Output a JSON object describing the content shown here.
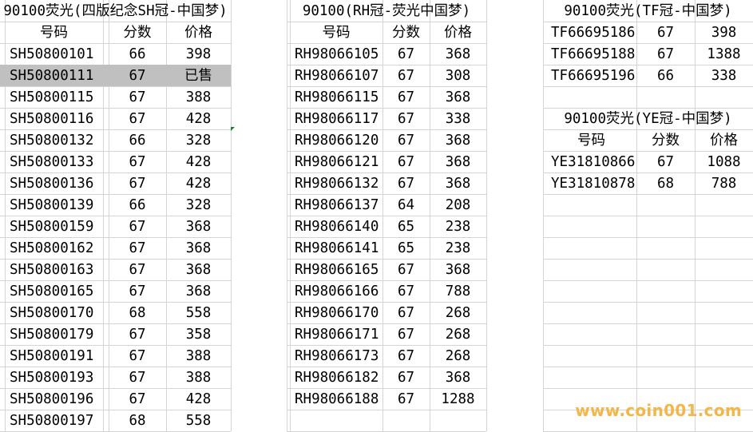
{
  "sections": [
    {
      "title": "90100荧光(四版纪念SH冠-中国梦)",
      "headers": [
        "号码",
        "分数",
        "价格"
      ],
      "rows": [
        [
          "SH50800101",
          "66",
          "398"
        ],
        [
          "SH50800111",
          "67",
          "已售"
        ],
        [
          "SH50800115",
          "67",
          "388"
        ],
        [
          "SH50800116",
          "67",
          "428"
        ],
        [
          "SH50800132",
          "66",
          "328"
        ],
        [
          "SH50800133",
          "67",
          "428"
        ],
        [
          "SH50800136",
          "67",
          "428"
        ],
        [
          "SH50800139",
          "66",
          "328"
        ],
        [
          "SH50800159",
          "67",
          "368"
        ],
        [
          "SH50800162",
          "67",
          "368"
        ],
        [
          "SH50800163",
          "67",
          "368"
        ],
        [
          "SH50800165",
          "67",
          "368"
        ],
        [
          "SH50800170",
          "68",
          "558"
        ],
        [
          "SH50800179",
          "67",
          "358"
        ],
        [
          "SH50800191",
          "67",
          "388"
        ],
        [
          "SH50800193",
          "67",
          "388"
        ],
        [
          "SH50800196",
          "67",
          "428"
        ],
        [
          "SH50800197",
          "68",
          "558"
        ]
      ]
    },
    {
      "title": "90100(RH冠-荧光中国梦)",
      "headers": [
        "号码",
        "分数",
        "价格"
      ],
      "rows": [
        [
          "RH98066105",
          "67",
          "368"
        ],
        [
          "RH98066107",
          "67",
          "308"
        ],
        [
          "RH98066115",
          "67",
          "368"
        ],
        [
          "RH98066117",
          "67",
          "338"
        ],
        [
          "RH98066120",
          "67",
          "368"
        ],
        [
          "RH98066121",
          "67",
          "368"
        ],
        [
          "RH98066132",
          "67",
          "368"
        ],
        [
          "RH98066137",
          "64",
          "208"
        ],
        [
          "RH98066140",
          "65",
          "238"
        ],
        [
          "RH98066141",
          "65",
          "238"
        ],
        [
          "RH98066165",
          "67",
          "368"
        ],
        [
          "RH98066166",
          "67",
          "788"
        ],
        [
          "RH98066170",
          "67",
          "268"
        ],
        [
          "RH98066171",
          "67",
          "268"
        ],
        [
          "RH98066173",
          "67",
          "268"
        ],
        [
          "RH98066182",
          "67",
          "368"
        ],
        [
          "RH98066188",
          "67",
          "1288"
        ]
      ]
    },
    {
      "title": "90100荧光(TF冠-中国梦)",
      "rows": [
        [
          "TF66695186",
          "67",
          "398"
        ],
        [
          "TF66695188",
          "67",
          "1388"
        ],
        [
          "TF66695196",
          "66",
          "338"
        ]
      ]
    },
    {
      "title": "90100荧光(YE冠-中国梦)",
      "headers": [
        "号码",
        "分数",
        "价格"
      ],
      "rows": [
        [
          "YE31810866",
          "67",
          "1088"
        ],
        [
          "YE31810878",
          "68",
          "788"
        ]
      ]
    }
  ],
  "watermark": "www.coin001.com",
  "colors": {
    "selected_row": "#c0c0c0",
    "gridline": "#d4d4d4",
    "watermark": "#f3b64b"
  }
}
